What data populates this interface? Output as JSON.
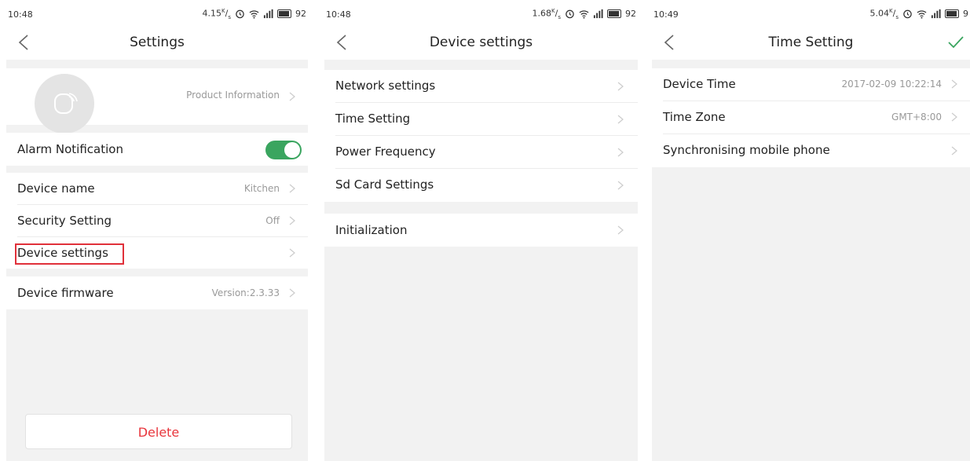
{
  "accent_color": "#3aa55f",
  "screens": [
    {
      "status": {
        "time": "10:48",
        "net": "4.15",
        "battery": "92"
      },
      "title": "Settings",
      "product_info": "Product Information",
      "alarm_notification": {
        "label": "Alarm Notification",
        "enabled": true
      },
      "rows": [
        {
          "label": "Device name",
          "value": "Kitchen"
        },
        {
          "label": "Security Setting",
          "value": "Off"
        },
        {
          "label": "Device settings",
          "value": ""
        },
        {
          "label": "Device firmware",
          "value": "Version:2.3.33"
        }
      ],
      "delete_label": "Delete"
    },
    {
      "status": {
        "time": "10:48",
        "net": "1.68",
        "battery": "92"
      },
      "title": "Device settings",
      "rows": [
        {
          "label": "Network settings"
        },
        {
          "label": "Time Setting"
        },
        {
          "label": "Power Frequency"
        },
        {
          "label": "Sd Card Settings"
        },
        {
          "label": "Initialization"
        }
      ]
    },
    {
      "status": {
        "time": "10:49",
        "net": "5.04",
        "battery": "9"
      },
      "title": "Time Setting",
      "rows": [
        {
          "label": "Device Time",
          "value": "2017-02-09 10:22:14"
        },
        {
          "label": "Time Zone",
          "value": "GMT+8:00"
        },
        {
          "label": "Synchronising mobile phone",
          "value": ""
        }
      ]
    }
  ]
}
